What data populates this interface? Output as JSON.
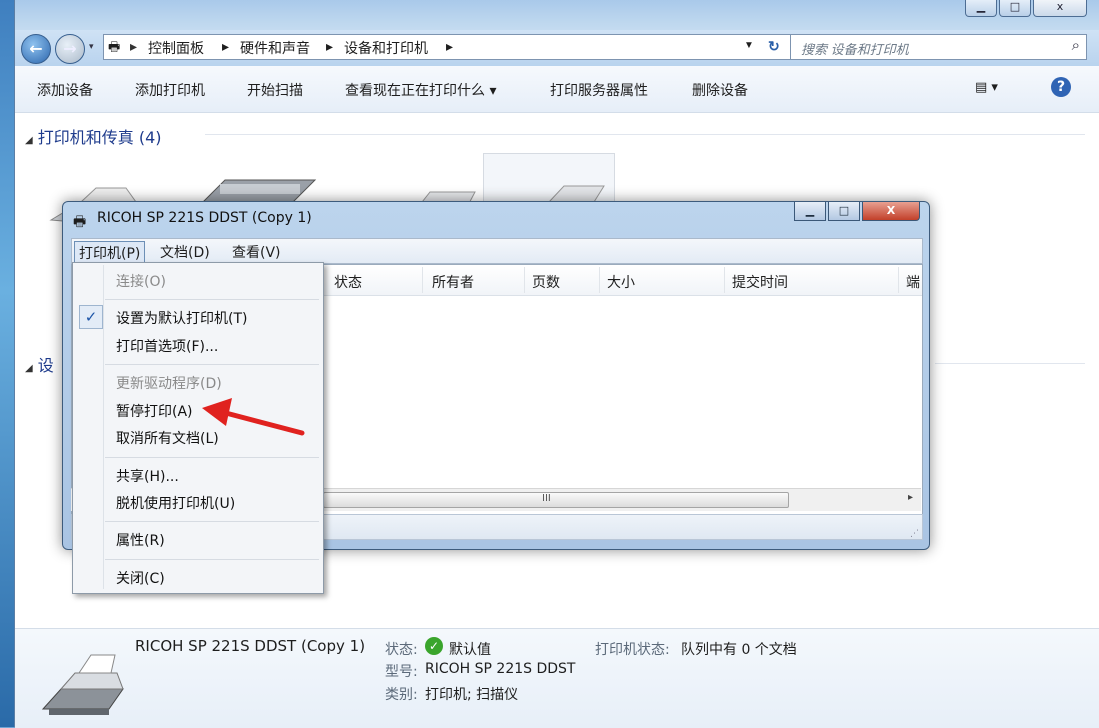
{
  "address": {
    "crumbs": [
      "控制面板",
      "硬件和声音",
      "设备和打印机"
    ],
    "search_placeholder": "搜索 设备和打印机"
  },
  "command_bar": {
    "items": [
      "添加设备",
      "添加打印机",
      "开始扫描",
      "查看现在正在打印什么 ▾",
      "打印服务器属性",
      "删除设备"
    ]
  },
  "groups": {
    "printers_heading": "打印机和传真 (4)",
    "devices_heading_partial": "设"
  },
  "dialog": {
    "title": "RICOH SP 221S DDST (Copy 1)",
    "menubar": [
      "打印机(P)",
      "文档(D)",
      "查看(V)"
    ],
    "columns": [
      "状态",
      "所有者",
      "页数",
      "大小",
      "提交时间",
      "端"
    ],
    "scroll_mark": "III"
  },
  "menu": {
    "items": [
      {
        "label": "连接(O)",
        "disabled": true
      },
      {
        "label": "设置为默认打印机(T)",
        "checked": true
      },
      {
        "label": "打印首选项(F)..."
      },
      {
        "label": "更新驱动程序(D)",
        "disabled": true
      },
      {
        "label": "暂停打印(A)"
      },
      {
        "label": "取消所有文档(L)"
      },
      {
        "label": "共享(H)..."
      },
      {
        "label": "脱机使用打印机(U)"
      },
      {
        "label": "属性(R)"
      },
      {
        "label": "关闭(C)"
      }
    ],
    "check_glyph": "✓"
  },
  "details": {
    "name": "RICOH SP 221S DDST (Copy 1)",
    "status_label": "状态:",
    "status_value": "默认值",
    "printer_status_label": "打印机状态:",
    "printer_status_value": "队列中有 0 个文档",
    "model_label": "型号:",
    "model_value": "RICOH SP 221S DDST",
    "category_label": "类别:",
    "category_value": "打印机; 扫描仪"
  },
  "colors": {
    "annotation_arrow": "#e0221f",
    "heading_blue": "#1e3b8c",
    "status_ok": "#3aa52c"
  },
  "icons": {
    "back": "back-arrow-icon",
    "forward": "forward-arrow-icon",
    "refresh": "refresh-icon",
    "search": "magnifier-icon",
    "help": "help-icon",
    "view": "view-options-icon",
    "printer": "printer-icon",
    "status_ok": "checkmark-circle-icon"
  }
}
